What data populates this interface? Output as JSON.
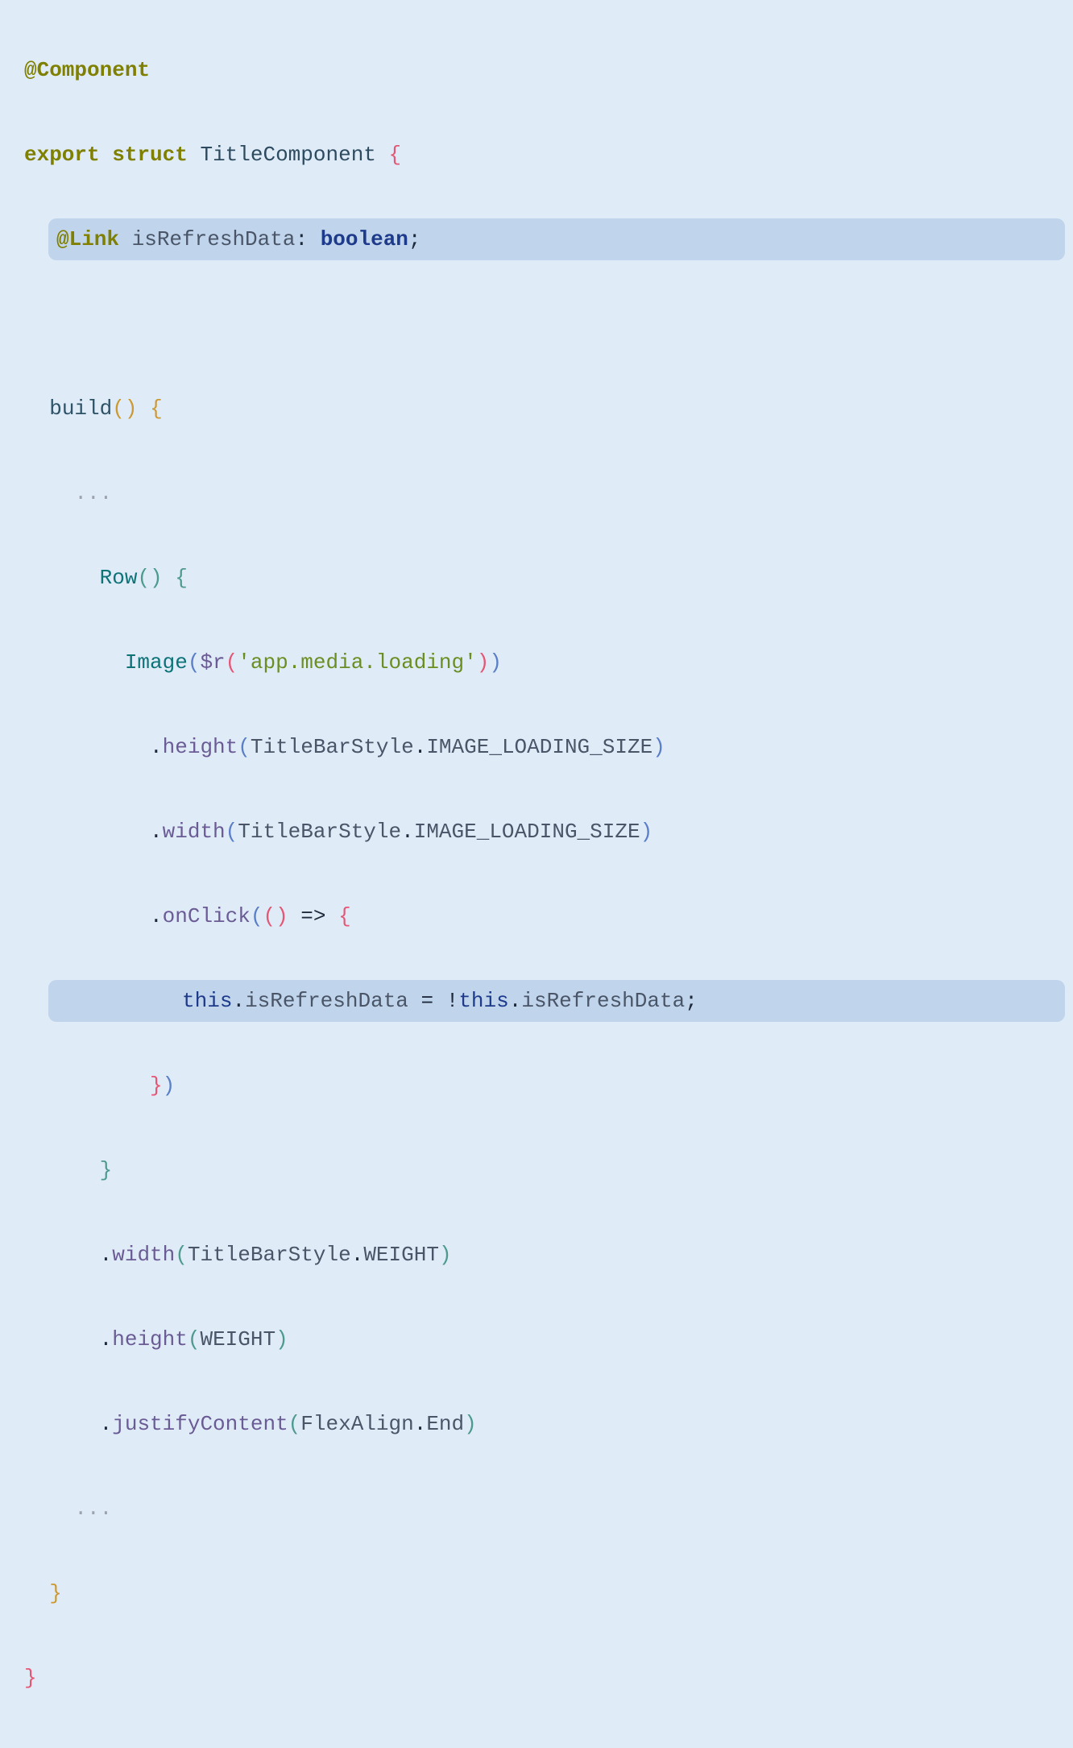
{
  "code": {
    "decorator_component": "@Component",
    "kw_export": "export",
    "kw_struct": "struct",
    "class_name": "TitleComponent",
    "decorator_link": "@Link",
    "field_name": "isRefreshData",
    "colon": ":",
    "type_boolean": "boolean",
    "semicolon": ";",
    "method_build": "build",
    "ellipsis": "...",
    "fn_row": "Row",
    "fn_image": "Image",
    "fn_dollar_r": "$r",
    "str_media": "'app.media.loading'",
    "method_height": "height",
    "method_width": "width",
    "method_onclick": "onClick",
    "method_justifyContent": "justifyContent",
    "class_titlebarstyle": "TitleBarStyle",
    "const_image_loading_size": "IMAGE_LOADING_SIZE",
    "const_weight": "WEIGHT",
    "class_flexalign": "FlexAlign",
    "const_end": "End",
    "arrow": "=>",
    "kw_this": "this",
    "dot": ".",
    "equals": " = ",
    "not": "!",
    "open_brace": "{",
    "close_brace": "}",
    "open_paren": "(",
    "close_paren": ")"
  }
}
